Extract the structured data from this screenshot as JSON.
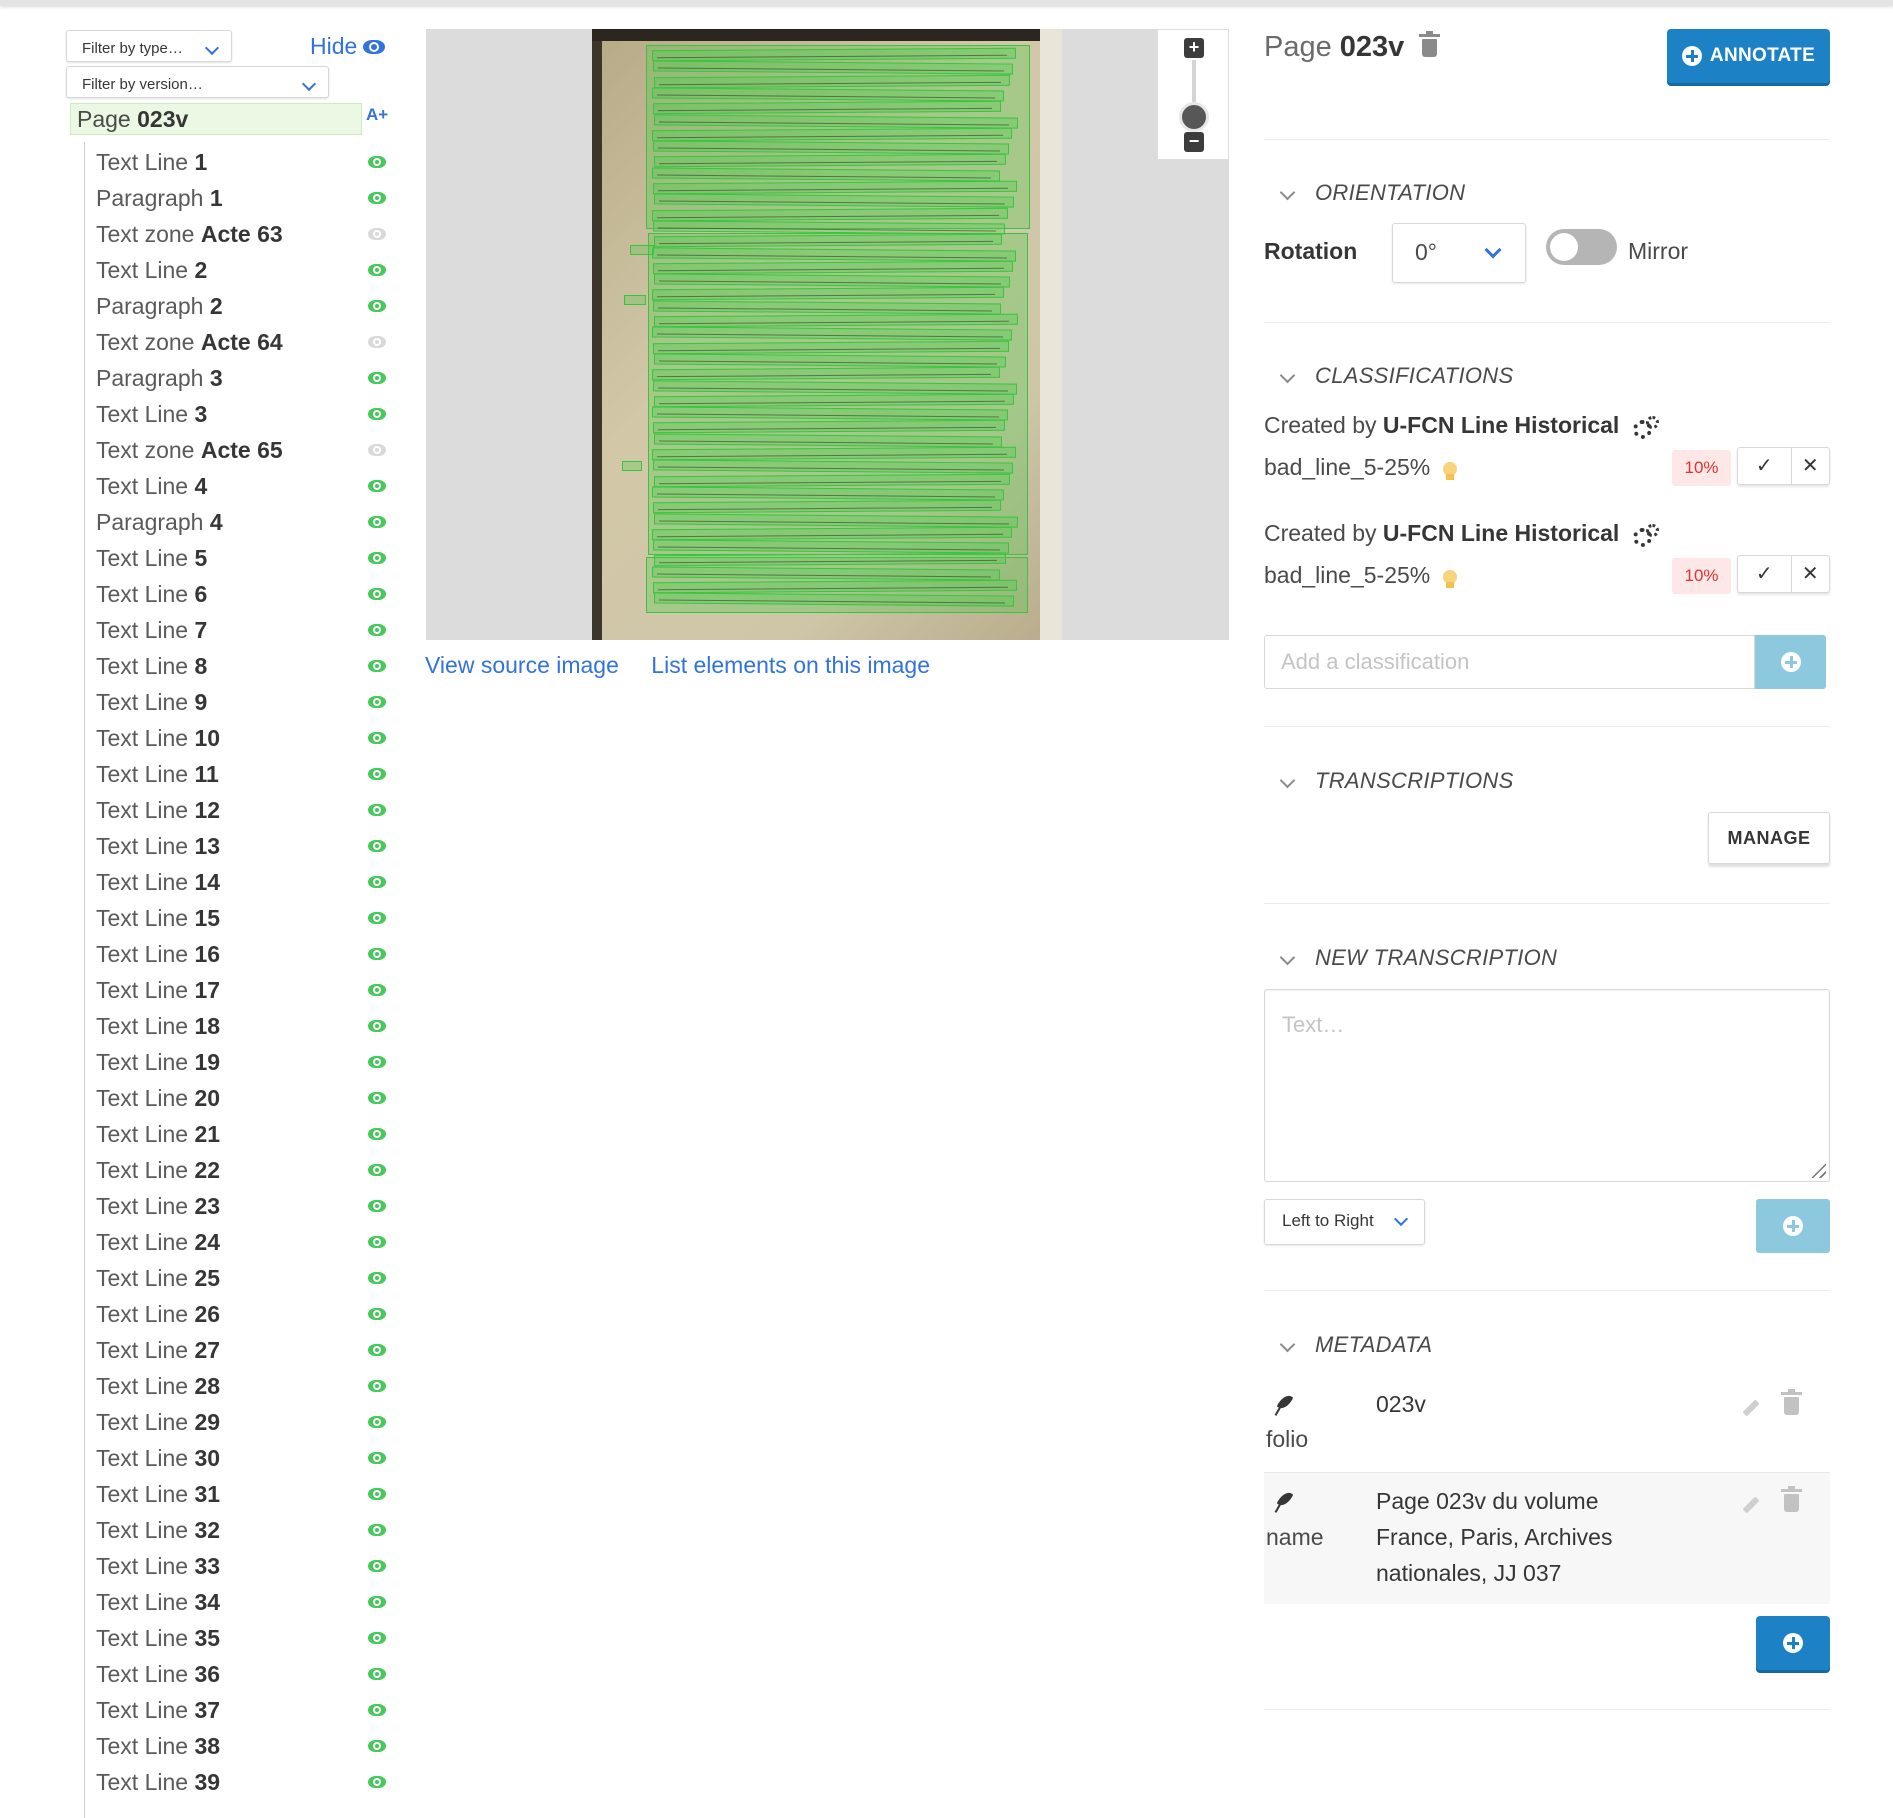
{
  "left_panel": {
    "filter_type_placeholder": "Filter by type…",
    "filter_version_placeholder": "Filter by version…",
    "hide_label": "Hide",
    "page_prefix": "Page",
    "page_name": "023v",
    "sort_label": "A+",
    "elements": [
      {
        "type": "Text Line",
        "name": "1",
        "visible": true
      },
      {
        "type": "Paragraph",
        "name": "1",
        "visible": true
      },
      {
        "type": "Text zone",
        "name": "Acte 63",
        "visible": false
      },
      {
        "type": "Text Line",
        "name": "2",
        "visible": true
      },
      {
        "type": "Paragraph",
        "name": "2",
        "visible": true
      },
      {
        "type": "Text zone",
        "name": "Acte 64",
        "visible": false
      },
      {
        "type": "Paragraph",
        "name": "3",
        "visible": true
      },
      {
        "type": "Text Line",
        "name": "3",
        "visible": true
      },
      {
        "type": "Text zone",
        "name": "Acte 65",
        "visible": false
      },
      {
        "type": "Text Line",
        "name": "4",
        "visible": true
      },
      {
        "type": "Paragraph",
        "name": "4",
        "visible": true
      },
      {
        "type": "Text Line",
        "name": "5",
        "visible": true
      },
      {
        "type": "Text Line",
        "name": "6",
        "visible": true
      },
      {
        "type": "Text Line",
        "name": "7",
        "visible": true
      },
      {
        "type": "Text Line",
        "name": "8",
        "visible": true
      },
      {
        "type": "Text Line",
        "name": "9",
        "visible": true
      },
      {
        "type": "Text Line",
        "name": "10",
        "visible": true
      },
      {
        "type": "Text Line",
        "name": "11",
        "visible": true
      },
      {
        "type": "Text Line",
        "name": "12",
        "visible": true
      },
      {
        "type": "Text Line",
        "name": "13",
        "visible": true
      },
      {
        "type": "Text Line",
        "name": "14",
        "visible": true
      },
      {
        "type": "Text Line",
        "name": "15",
        "visible": true
      },
      {
        "type": "Text Line",
        "name": "16",
        "visible": true
      },
      {
        "type": "Text Line",
        "name": "17",
        "visible": true
      },
      {
        "type": "Text Line",
        "name": "18",
        "visible": true
      },
      {
        "type": "Text Line",
        "name": "19",
        "visible": true
      },
      {
        "type": "Text Line",
        "name": "20",
        "visible": true
      },
      {
        "type": "Text Line",
        "name": "21",
        "visible": true
      },
      {
        "type": "Text Line",
        "name": "22",
        "visible": true
      },
      {
        "type": "Text Line",
        "name": "23",
        "visible": true
      },
      {
        "type": "Text Line",
        "name": "24",
        "visible": true
      },
      {
        "type": "Text Line",
        "name": "25",
        "visible": true
      },
      {
        "type": "Text Line",
        "name": "26",
        "visible": true
      },
      {
        "type": "Text Line",
        "name": "27",
        "visible": true
      },
      {
        "type": "Text Line",
        "name": "28",
        "visible": true
      },
      {
        "type": "Text Line",
        "name": "29",
        "visible": true
      },
      {
        "type": "Text Line",
        "name": "30",
        "visible": true
      },
      {
        "type": "Text Line",
        "name": "31",
        "visible": true
      },
      {
        "type": "Text Line",
        "name": "32",
        "visible": true
      },
      {
        "type": "Text Line",
        "name": "33",
        "visible": true
      },
      {
        "type": "Text Line",
        "name": "34",
        "visible": true
      },
      {
        "type": "Text Line",
        "name": "35",
        "visible": true
      },
      {
        "type": "Text Line",
        "name": "36",
        "visible": true
      },
      {
        "type": "Text Line",
        "name": "37",
        "visible": true
      },
      {
        "type": "Text Line",
        "name": "38",
        "visible": true
      },
      {
        "type": "Text Line",
        "name": "39",
        "visible": true
      }
    ]
  },
  "viewer": {
    "zoom_in_label": "+",
    "zoom_out_label": "−",
    "view_source_label": "View source image",
    "list_elements_label": "List elements on this image"
  },
  "details": {
    "page_prefix": "Page",
    "page_name": "023v",
    "annotate_label": "ANNOTATE",
    "orientation": {
      "title": "ORIENTATION",
      "rotation_label": "Rotation",
      "rotation_value": "0°",
      "mirror_label": "Mirror",
      "mirror_on": false
    },
    "classifications": {
      "title": "CLASSIFICATIONS",
      "created_by_label": "Created by",
      "items": [
        {
          "creator": "U-FCN Line Historical",
          "name": "bad_line_5-25%",
          "confidence": "10%"
        },
        {
          "creator": "U-FCN Line Historical",
          "name": "bad_line_5-25%",
          "confidence": "10%"
        }
      ],
      "validate_glyph": "✓",
      "reject_glyph": "✕",
      "add_placeholder": "Add a classification"
    },
    "transcriptions": {
      "title": "TRANSCRIPTIONS",
      "manage_label": "MANAGE"
    },
    "new_transcription": {
      "title": "NEW TRANSCRIPTION",
      "placeholder": "Text…",
      "direction": "Left to Right"
    },
    "metadata": {
      "title": "METADATA",
      "items": [
        {
          "key": "folio",
          "value": "023v"
        },
        {
          "key": "name",
          "value": "Page 023v du volume France, Paris, Archives nationales, JJ 037"
        }
      ]
    }
  },
  "colors": {
    "accent": "#3273dc",
    "primary_button": "#1c82c5",
    "disabled_button": "#8cc8de",
    "visible_eye": "#48c75a",
    "hidden_eye": "#d9d9d9",
    "selected_row": "#ebf8e3",
    "annotation_box": "#39c43f"
  }
}
